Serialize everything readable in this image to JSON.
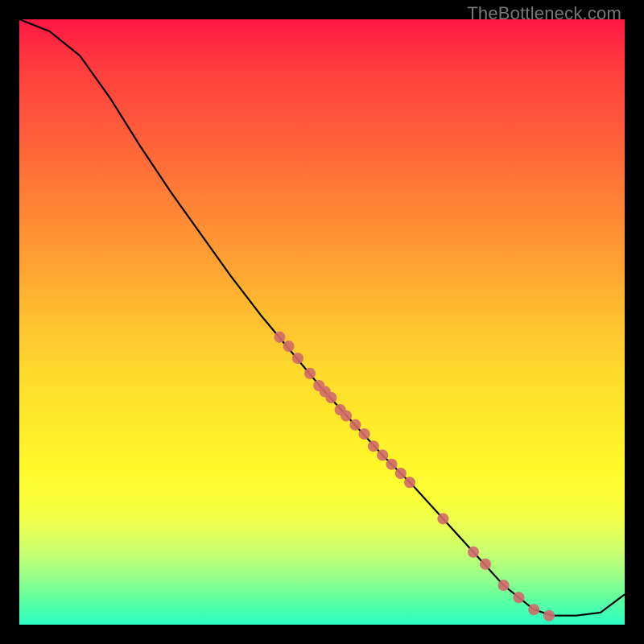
{
  "watermark": "TheBottleneck.com",
  "chart_data": {
    "type": "line",
    "title": "",
    "xlabel": "",
    "ylabel": "",
    "xlim": [
      0,
      100
    ],
    "ylim": [
      0,
      100
    ],
    "grid": false,
    "legend": false,
    "background": "red-yellow-green vertical gradient",
    "curve": [
      {
        "x": 0.0,
        "y": 100.0
      },
      {
        "x": 5.0,
        "y": 98.0
      },
      {
        "x": 10.0,
        "y": 94.0
      },
      {
        "x": 15.0,
        "y": 87.0
      },
      {
        "x": 20.0,
        "y": 79.0
      },
      {
        "x": 25.0,
        "y": 71.5
      },
      {
        "x": 30.0,
        "y": 64.5
      },
      {
        "x": 35.0,
        "y": 57.5
      },
      {
        "x": 40.0,
        "y": 51.0
      },
      {
        "x": 45.0,
        "y": 45.0
      },
      {
        "x": 50.0,
        "y": 39.0
      },
      {
        "x": 55.0,
        "y": 33.5
      },
      {
        "x": 60.0,
        "y": 28.0
      },
      {
        "x": 65.0,
        "y": 23.0
      },
      {
        "x": 70.0,
        "y": 17.5
      },
      {
        "x": 75.0,
        "y": 12.0
      },
      {
        "x": 80.0,
        "y": 6.5
      },
      {
        "x": 85.0,
        "y": 2.5
      },
      {
        "x": 88.0,
        "y": 1.5
      },
      {
        "x": 92.0,
        "y": 1.5
      },
      {
        "x": 96.0,
        "y": 2.0
      },
      {
        "x": 100.0,
        "y": 5.0
      }
    ],
    "markers": [
      {
        "x": 43.0,
        "y": 47.5
      },
      {
        "x": 44.5,
        "y": 46.0
      },
      {
        "x": 46.0,
        "y": 44.0
      },
      {
        "x": 48.0,
        "y": 41.5
      },
      {
        "x": 49.5,
        "y": 39.5
      },
      {
        "x": 50.5,
        "y": 38.5
      },
      {
        "x": 51.5,
        "y": 37.5
      },
      {
        "x": 53.0,
        "y": 35.5
      },
      {
        "x": 54.0,
        "y": 34.5
      },
      {
        "x": 55.5,
        "y": 33.0
      },
      {
        "x": 57.0,
        "y": 31.5
      },
      {
        "x": 58.5,
        "y": 29.5
      },
      {
        "x": 60.0,
        "y": 28.0
      },
      {
        "x": 61.5,
        "y": 26.5
      },
      {
        "x": 63.0,
        "y": 25.0
      },
      {
        "x": 64.5,
        "y": 23.5
      },
      {
        "x": 70.0,
        "y": 17.5
      },
      {
        "x": 75.0,
        "y": 12.0
      },
      {
        "x": 77.0,
        "y": 10.0
      },
      {
        "x": 80.0,
        "y": 6.5
      },
      {
        "x": 82.5,
        "y": 4.5
      },
      {
        "x": 85.0,
        "y": 2.5
      },
      {
        "x": 87.5,
        "y": 1.5
      }
    ],
    "marker_color": "#d16a6a",
    "line_color": "#000000"
  }
}
